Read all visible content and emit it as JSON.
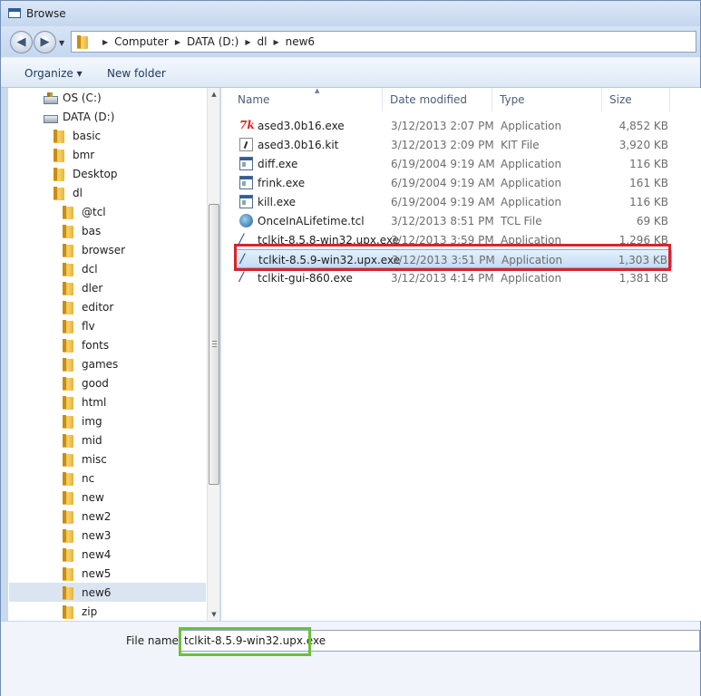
{
  "window": {
    "title": "Browse"
  },
  "address": {
    "crumbs": [
      "Computer",
      "DATA (D:)",
      "dl",
      "new6"
    ]
  },
  "toolbar": {
    "organize_label": "Organize ▾",
    "new_folder_label": "New folder"
  },
  "nav_items": [
    "OS (C:)",
    "DATA (D:)",
    "basic",
    "bmr",
    "Desktop",
    "dl",
    "@tcl",
    "bas",
    "browser",
    "dcl",
    "dler",
    "editor",
    "flv",
    "fonts",
    "games",
    "good",
    "html",
    "img",
    "mid",
    "misc",
    "nc",
    "new",
    "new2",
    "new3",
    "new4",
    "new5",
    "new6",
    "zip"
  ],
  "columns": {
    "name": "Name",
    "date": "Date modified",
    "type": "Type",
    "size": "Size"
  },
  "files": [
    {
      "name": "ased3.0b16.exe",
      "date": "3/12/2013 2:07 PM",
      "type": "Application",
      "size": "4,852 KB",
      "icon": "tk-app-icon"
    },
    {
      "name": "ased3.0b16.kit",
      "date": "3/12/2013 2:09 PM",
      "type": "KIT File",
      "size": "3,920 KB",
      "icon": "kit-file-icon"
    },
    {
      "name": "diff.exe",
      "date": "6/19/2004 9:19 AM",
      "type": "Application",
      "size": "116 KB",
      "icon": "app-window-icon"
    },
    {
      "name": "frink.exe",
      "date": "6/19/2004 9:19 AM",
      "type": "Application",
      "size": "161 KB",
      "icon": "app-window-icon"
    },
    {
      "name": "kill.exe",
      "date": "6/19/2004 9:19 AM",
      "type": "Application",
      "size": "116 KB",
      "icon": "app-window-icon"
    },
    {
      "name": "OnceInALifetime.tcl",
      "date": "3/12/2013 8:51 PM",
      "type": "TCL File",
      "size": "69 KB",
      "icon": "tcl-file-icon"
    },
    {
      "name": "tclkit-8.5.8-win32.upx.exe",
      "date": "3/12/2013 3:59 PM",
      "type": "Application",
      "size": "1,296 KB",
      "icon": "feather-icon"
    },
    {
      "name": "tclkit-8.5.9-win32.upx.exe",
      "date": "3/12/2013 3:51 PM",
      "type": "Application",
      "size": "1,303 KB",
      "icon": "feather-icon"
    },
    {
      "name": "tclkit-gui-860.exe",
      "date": "3/12/2013 4:14 PM",
      "type": "Application",
      "size": "1,381 KB",
      "icon": "feather-icon"
    }
  ],
  "filename": {
    "label": "File name:",
    "value": "tclkit-8.5.9-win32.upx.exe"
  },
  "colors": {
    "highlight_red": "#d8242b",
    "highlight_green": "#6cc03a",
    "selection": "#c4dcf5"
  }
}
